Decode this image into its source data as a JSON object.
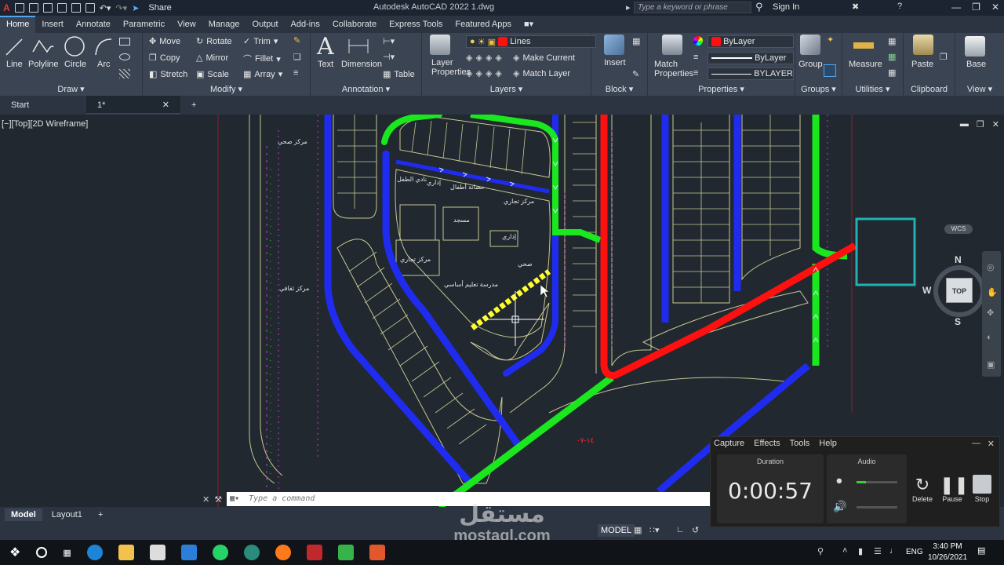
{
  "titlebar": {
    "share": "Share",
    "app_title": "Autodesk AutoCAD 2022    1.dwg",
    "search_placeholder": "Type a keyword or phrase",
    "sign_in": "Sign In"
  },
  "ribbon_tabs": [
    "Home",
    "Insert",
    "Annotate",
    "Parametric",
    "View",
    "Manage",
    "Output",
    "Add-ins",
    "Collaborate",
    "Express Tools",
    "Featured Apps"
  ],
  "ribbon": {
    "draw": {
      "title": "Draw",
      "line": "Line",
      "polyline": "Polyline",
      "circle": "Circle",
      "arc": "Arc"
    },
    "modify": {
      "title": "Modify",
      "move": "Move",
      "rotate": "Rotate",
      "trim": "Trim",
      "copy": "Copy",
      "mirror": "Mirror",
      "fillet": "Fillet",
      "stretch": "Stretch",
      "scale": "Scale",
      "array": "Array"
    },
    "annotation": {
      "title": "Annotation",
      "text": "Text",
      "dimension": "Dimension",
      "table": "Table"
    },
    "layers": {
      "title": "Layers",
      "layer_properties": "Layer Properties",
      "current_layer": "Lines",
      "make_current": "Make Current",
      "match_layer": "Match Layer"
    },
    "block": {
      "title": "Block",
      "insert": "Insert"
    },
    "properties": {
      "title": "Properties",
      "match_properties": "Match Properties",
      "color": "ByLayer",
      "linetype": "ByLayer",
      "lineweight": "BYLAYER"
    },
    "groups": {
      "title": "Groups",
      "group": "Group"
    },
    "utilities": {
      "title": "Utilities",
      "measure": "Measure"
    },
    "clipboard": {
      "title": "Clipboard",
      "paste": "Paste"
    },
    "view": {
      "title": "View",
      "base": "Base"
    }
  },
  "doc_tabs": {
    "start": "Start",
    "active": "1*"
  },
  "viewport": {
    "label": "[−][Top][2D Wireframe]",
    "navcube": {
      "n": "N",
      "s": "S",
      "e": "E",
      "w": "W",
      "top": "TOP",
      "wcs": "WCS"
    },
    "drawing_texts": {
      "t1": "مركز صحي",
      "t2": "نادي الطفل",
      "t3": "إداري",
      "t4": "حضانة أطفال",
      "t5": "مركز تجاري",
      "t6": "مسجد",
      "t7": "إداري",
      "t8": "مركز تجاري",
      "t9": "صحي",
      "t10": "مدرسة تعليم أساسي",
      "t11": "مركز ثقافي",
      "t12": "١٤-٠٧"
    }
  },
  "command": {
    "placeholder": "Type a command"
  },
  "layout_tabs": [
    "Model",
    "Layout1"
  ],
  "status": {
    "model": "MODEL"
  },
  "recorder": {
    "menu": [
      "Capture",
      "Effects",
      "Tools",
      "Help"
    ],
    "duration_label": "Duration",
    "audio_label": "Audio",
    "time": "0:00:57",
    "delete": "Delete",
    "pause": "Pause",
    "stop": "Stop"
  },
  "watermark": {
    "arabic": "مستقل",
    "latin": "mostaql.com"
  },
  "taskbar": {
    "lang": "ENG",
    "time": "3:40 PM",
    "date": "10/26/2021"
  },
  "colors": {
    "accent": "#53a6ee",
    "road_blue": "#1f2cf0",
    "road_green": "#19e81e",
    "road_red": "#ff1010",
    "highlight": "#ffff30",
    "viewport_bg": "#212830"
  }
}
